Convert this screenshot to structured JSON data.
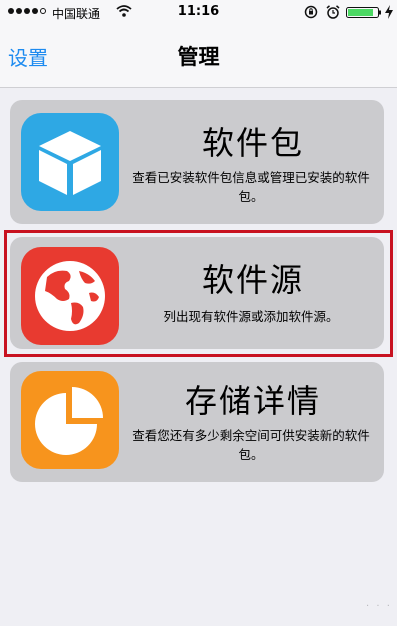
{
  "status_bar": {
    "carrier": "中国联通",
    "time": "11:16"
  },
  "nav": {
    "back_label": "设置",
    "title": "管理"
  },
  "cards": [
    {
      "title": "软件包",
      "description": "查看已安装软件包信息或管理已安装的软件包。",
      "icon": "package-box-icon",
      "icon_color": "#2ea8e4"
    },
    {
      "title": "软件源",
      "description": "列出现有软件源或添加软件源。",
      "icon": "globe-icon",
      "icon_color": "#e83a30"
    },
    {
      "title": "存储详情",
      "description": "查看您还有多少剩余空间可供安装新的软件包。",
      "icon": "pie-chart-icon",
      "icon_color": "#f7941d"
    }
  ],
  "colors": {
    "accent": "#1d8bf0",
    "highlight_border": "#c81220",
    "card_background": "#cbcbce"
  }
}
